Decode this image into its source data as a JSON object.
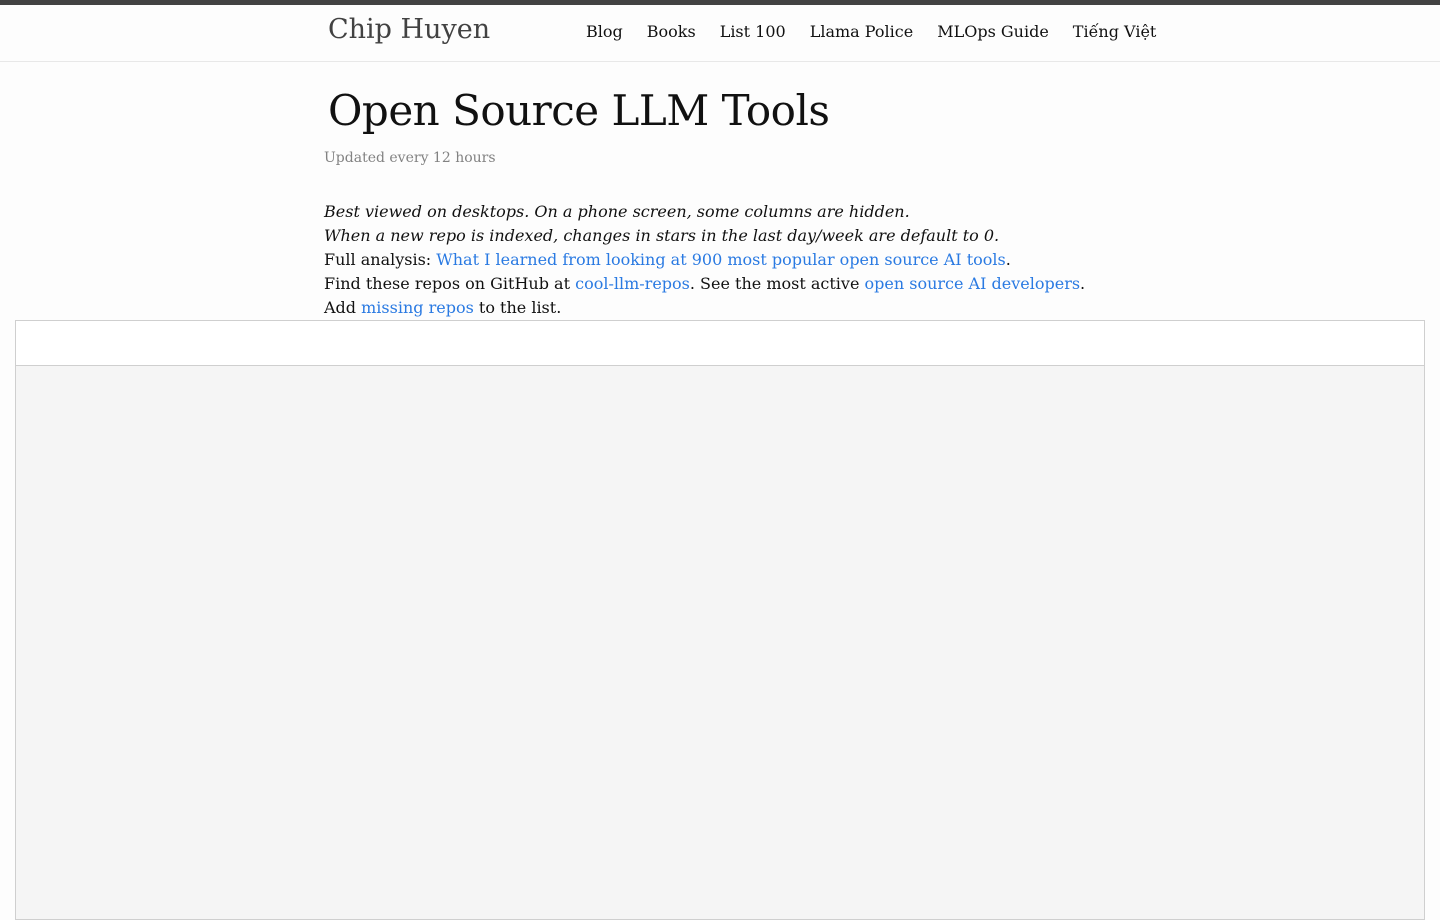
{
  "header": {
    "site_title": "Chip Huyen",
    "nav": [
      {
        "label": "Blog"
      },
      {
        "label": "Books"
      },
      {
        "label": "List 100"
      },
      {
        "label": "Llama Police"
      },
      {
        "label": "MLOps Guide"
      },
      {
        "label": "Tiếng Việt"
      }
    ]
  },
  "main": {
    "title": "Open Source LLM Tools",
    "updated": "Updated every 12 hours",
    "intro": {
      "line1": "Best viewed on desktops. On a phone screen, some columns are hidden.",
      "line2": "When a new repo is indexed, changes in stars in the last day/week are default to 0.",
      "line3_prefix": "Full analysis: ",
      "line3_link": "What I learned from looking at 900 most popular open source AI tools",
      "line3_suffix": ".",
      "line4_prefix": "Find these repos on GitHub at ",
      "line4_link1": "cool-llm-repos",
      "line4_middle": ". See the most active ",
      "line4_link2": "open source AI developers",
      "line4_suffix": ".",
      "line5_prefix": "Add ",
      "line5_link": "missing repos",
      "line5_suffix": " to the list."
    }
  },
  "colors": {
    "link": "#2a7ae2",
    "top_bar": "#424242",
    "muted": "#828282"
  }
}
